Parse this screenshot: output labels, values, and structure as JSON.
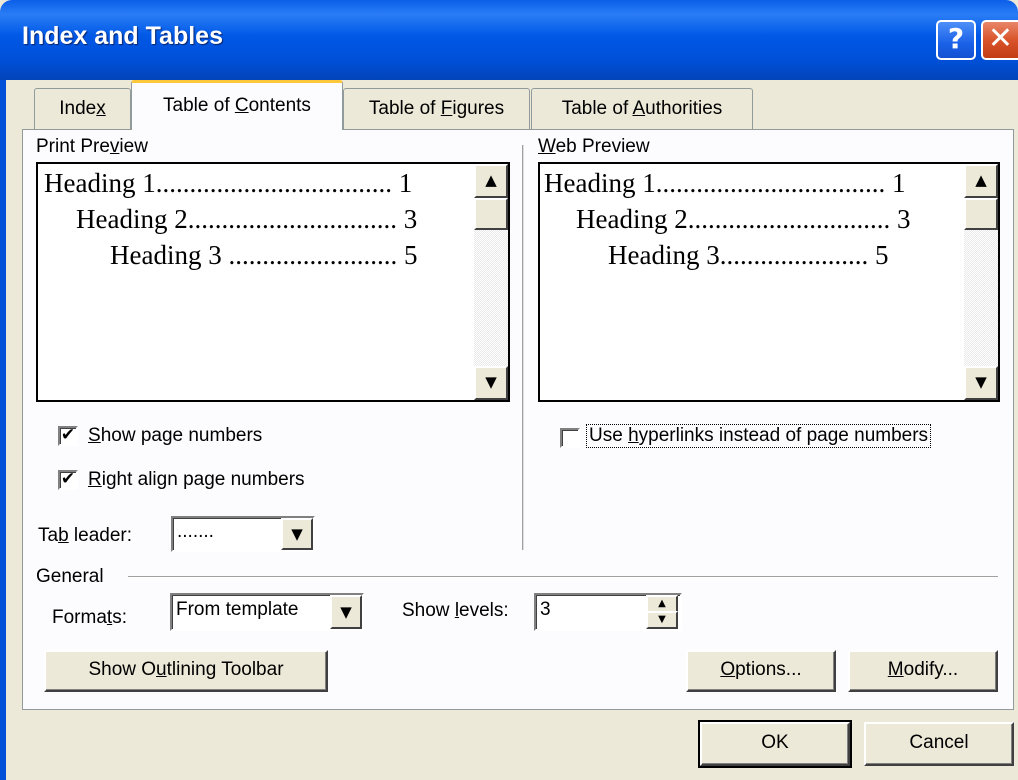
{
  "window": {
    "title": "Index and Tables",
    "help_glyph": "?",
    "close_glyph": "✕"
  },
  "tabs": [
    {
      "pre": "Inde",
      "key": "x",
      "post": ""
    },
    {
      "pre": "Table of ",
      "key": "C",
      "post": "ontents"
    },
    {
      "pre": "Table of ",
      "key": "F",
      "post": "igures"
    },
    {
      "pre": "Table of ",
      "key": "A",
      "post": "uthorities"
    }
  ],
  "print_preview": {
    "label_pre": "Print Pre",
    "label_key": "v",
    "label_post": "iew",
    "lines": [
      {
        "text": "Heading 1",
        "dots": "...................................",
        "page": "1"
      },
      {
        "text": "Heading 2",
        "dots": "...............................",
        "page": "3"
      },
      {
        "text": "Heading 3",
        "dots": ".........................",
        "page": "5"
      }
    ]
  },
  "web_preview": {
    "label_pre": "",
    "label_key": "W",
    "label_post": "eb Preview",
    "lines": [
      {
        "text": "Heading 1",
        "dots": "..................................",
        "page": "1"
      },
      {
        "text": "Heading 2",
        "dots": "..............................",
        "page": "3"
      },
      {
        "text": "Heading 3",
        "dots": "......................",
        "page": "5"
      }
    ]
  },
  "scroll": {
    "up": "▲",
    "down": "▼"
  },
  "options": {
    "show_page_numbers": {
      "pre": "",
      "key": "S",
      "post": "how page numbers",
      "checked": true
    },
    "right_align": {
      "pre": "",
      "key": "R",
      "post": "ight align page numbers",
      "checked": true
    },
    "use_hyperlinks": {
      "pre": "Use ",
      "key": "h",
      "post": "yperlinks instead of page numbers",
      "checked": false
    },
    "check_glyph": "✔"
  },
  "tab_leader": {
    "label_pre": "Ta",
    "label_key": "b",
    "label_post": " leader:",
    "value": ".......",
    "arrow": "▼"
  },
  "general": {
    "heading": "General",
    "formats": {
      "label_pre": "Forma",
      "label_key": "t",
      "label_post": "s:",
      "value": "From template",
      "arrow": "▼"
    },
    "levels": {
      "label_pre": "Show ",
      "label_key": "l",
      "label_post": "evels:",
      "value": "3",
      "up": "▲",
      "down": "▼"
    }
  },
  "buttons": {
    "outlining": {
      "pre": "Show O",
      "key": "u",
      "post": "tlining Toolbar"
    },
    "options": {
      "pre": "",
      "key": "O",
      "post": "ptions..."
    },
    "modify": {
      "pre": "",
      "key": "M",
      "post": "odify..."
    },
    "ok": "OK",
    "cancel": "Cancel"
  }
}
